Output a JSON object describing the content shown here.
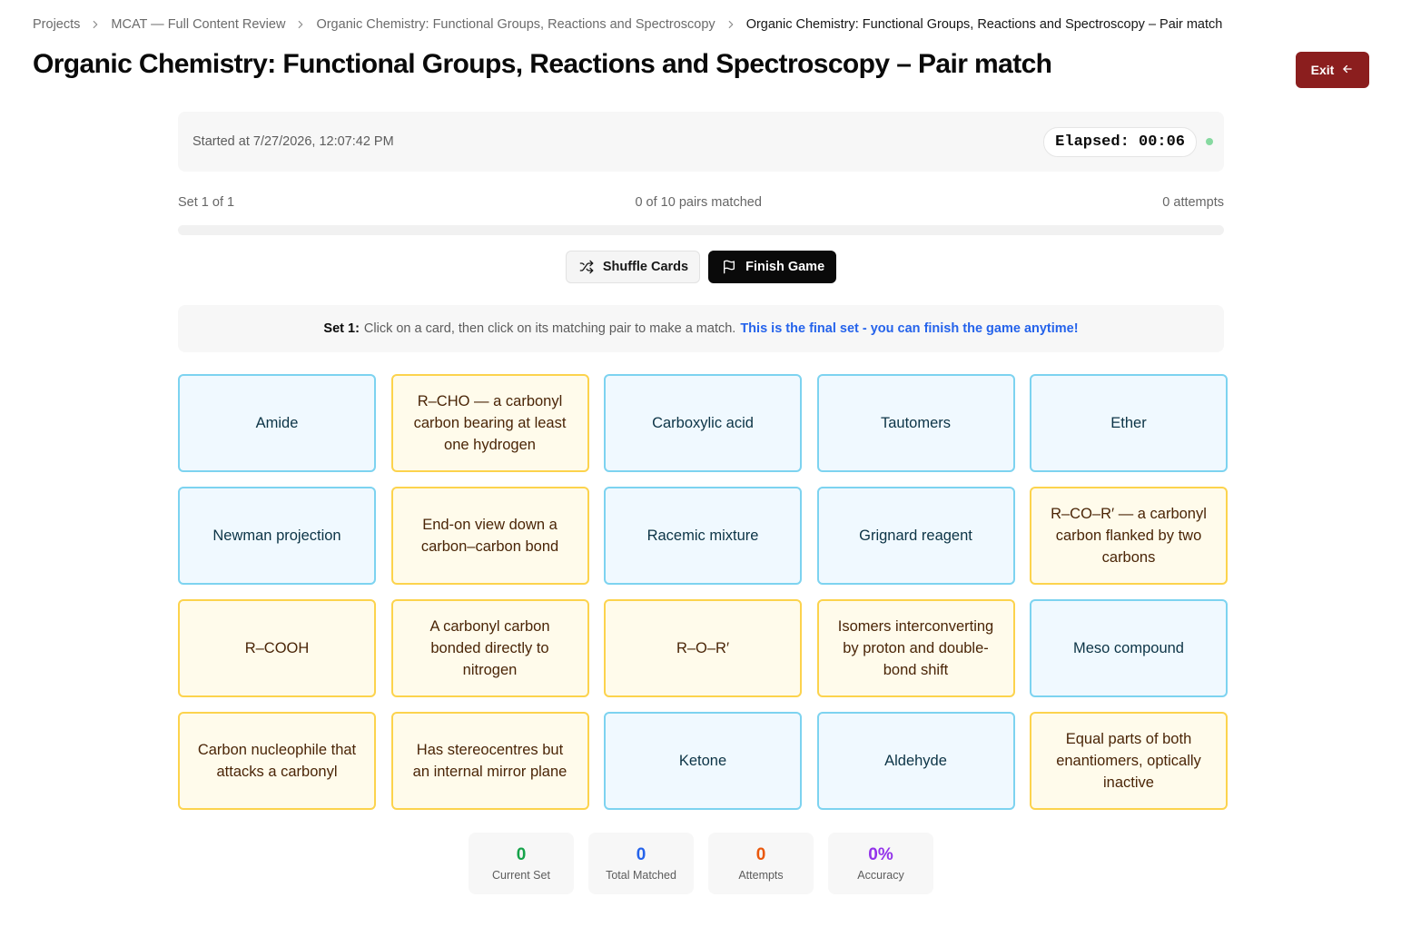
{
  "breadcrumb": [
    {
      "label": "Projects"
    },
    {
      "label": "MCAT — Full Content Review"
    },
    {
      "label": "Organic Chemistry: Functional Groups, Reactions and Spectroscopy"
    },
    {
      "label": "Organic Chemistry: Functional Groups, Reactions and Spectroscopy – Pair match"
    }
  ],
  "page_title": "Organic Chemistry: Functional Groups, Reactions and Spectroscopy – Pair match",
  "exit_label": "Exit",
  "status": {
    "started": "Started at 7/27/2026, 12:07:42 PM",
    "elapsed": "Elapsed: 00:06"
  },
  "progress": {
    "set_label": "Set 1 of 1",
    "pairs_label": "0 of 10 pairs matched",
    "attempts_label": "0 attempts",
    "fraction": 0
  },
  "controls": {
    "shuffle_label": "Shuffle Cards",
    "finish_label": "Finish Game"
  },
  "instructions": {
    "set_label": "Set 1:",
    "text": "Click on a card, then click on its matching pair to make a match.",
    "final_note": "This is the final set - you can finish the game anytime!"
  },
  "cards": [
    {
      "text": "Amide",
      "kind": "term"
    },
    {
      "text": "R–CHO — a carbonyl carbon bearing at least one hydrogen",
      "kind": "definition"
    },
    {
      "text": "Carboxylic acid",
      "kind": "term"
    },
    {
      "text": "Tautomers",
      "kind": "term"
    },
    {
      "text": "Ether",
      "kind": "term"
    },
    {
      "text": "Newman projection",
      "kind": "term"
    },
    {
      "text": "End-on view down a carbon–carbon bond",
      "kind": "definition"
    },
    {
      "text": "Racemic mixture",
      "kind": "term"
    },
    {
      "text": "Grignard reagent",
      "kind": "term"
    },
    {
      "text": "R–CO–R′ — a carbonyl carbon flanked by two carbons",
      "kind": "definition"
    },
    {
      "text": "R–COOH",
      "kind": "definition"
    },
    {
      "text": "A carbonyl carbon bonded directly to nitrogen",
      "kind": "definition"
    },
    {
      "text": "R–O–R′",
      "kind": "definition"
    },
    {
      "text": "Isomers interconverting by proton and double-bond shift",
      "kind": "definition"
    },
    {
      "text": "Meso compound",
      "kind": "term"
    },
    {
      "text": "Carbon nucleophile that attacks a carbonyl",
      "kind": "definition"
    },
    {
      "text": "Has stereocentres but an internal mirror plane",
      "kind": "definition"
    },
    {
      "text": "Ketone",
      "kind": "term"
    },
    {
      "text": "Aldehyde",
      "kind": "term"
    },
    {
      "text": "Equal parts of both enantiomers, optically inactive",
      "kind": "definition"
    }
  ],
  "stats": [
    {
      "value": "0",
      "label": "Current Set",
      "color": "#16a34a"
    },
    {
      "value": "0",
      "label": "Total Matched",
      "color": "#2563eb"
    },
    {
      "value": "0",
      "label": "Attempts",
      "color": "#ea580c"
    },
    {
      "value": "0%",
      "label": "Accuracy",
      "color": "#9333ea"
    }
  ],
  "icons": {
    "breadcrumb_separator": "chevron-right-icon",
    "exit": "arrow-left-icon",
    "shuffle": "shuffle-icon",
    "finish": "flag-icon"
  },
  "colors": {
    "exit_button": "#8b1e1e",
    "term_card_bg": "#f0f9ff",
    "term_card_border": "#7dd3f0",
    "definition_card_bg": "#fffbeb",
    "definition_card_border": "#fcd34d",
    "final_note": "#2563eb"
  }
}
